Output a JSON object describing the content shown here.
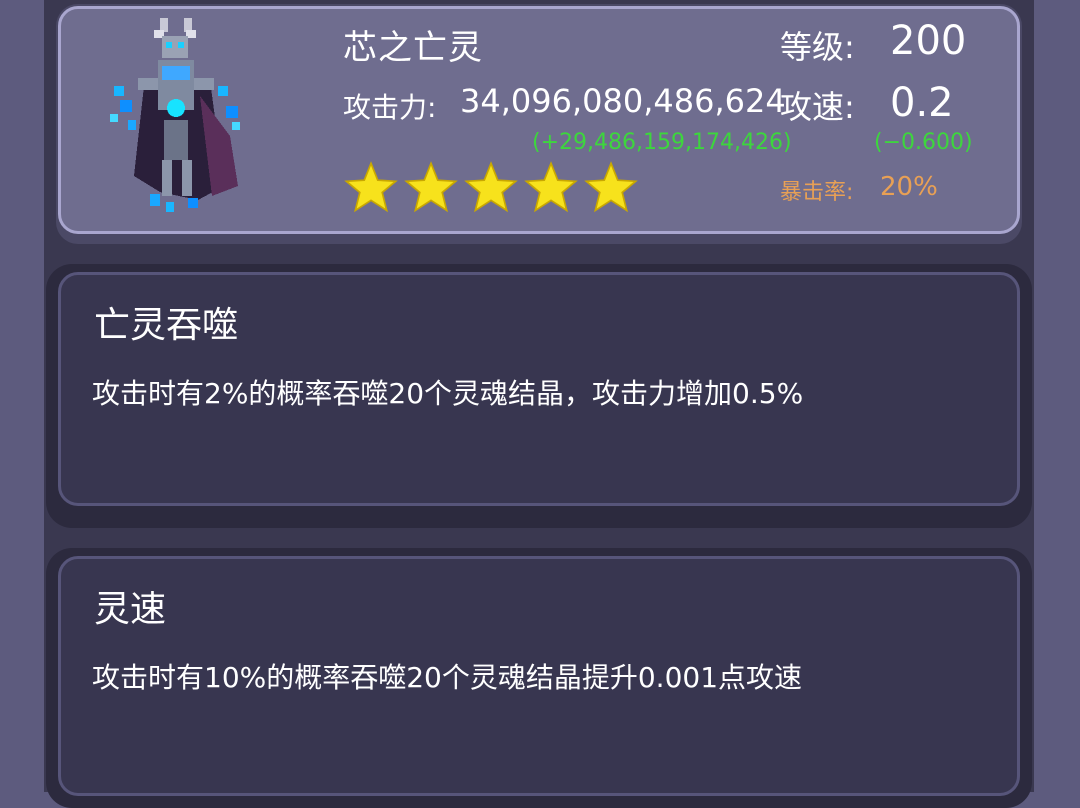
{
  "hero": {
    "name": "芯之亡灵",
    "attack_label": "攻击力:",
    "attack_value": "34,096,080,486,624",
    "attack_bonus": "(+29,486,159,174,426)",
    "level_label": "等级:",
    "level_value": "200",
    "speed_label": "攻速:",
    "speed_value": "0.2",
    "speed_bonus": "(−0.600)",
    "crit_label": "暴击率:",
    "crit_value": "20%",
    "stars": 5,
    "star_color": "#f7e21c",
    "bonus_color": "#3dd63d",
    "crit_color": "#e8a055",
    "portrait_icon": "undead-knight-pixel-portrait"
  },
  "skills": [
    {
      "title": "亡灵吞噬",
      "description": "攻击时有2%的概率吞噬20个灵魂结晶，攻击力增加0.5%"
    },
    {
      "title": "灵速",
      "description": "攻击时有10%的概率吞噬20个灵魂结晶提升0.001点攻速"
    }
  ]
}
